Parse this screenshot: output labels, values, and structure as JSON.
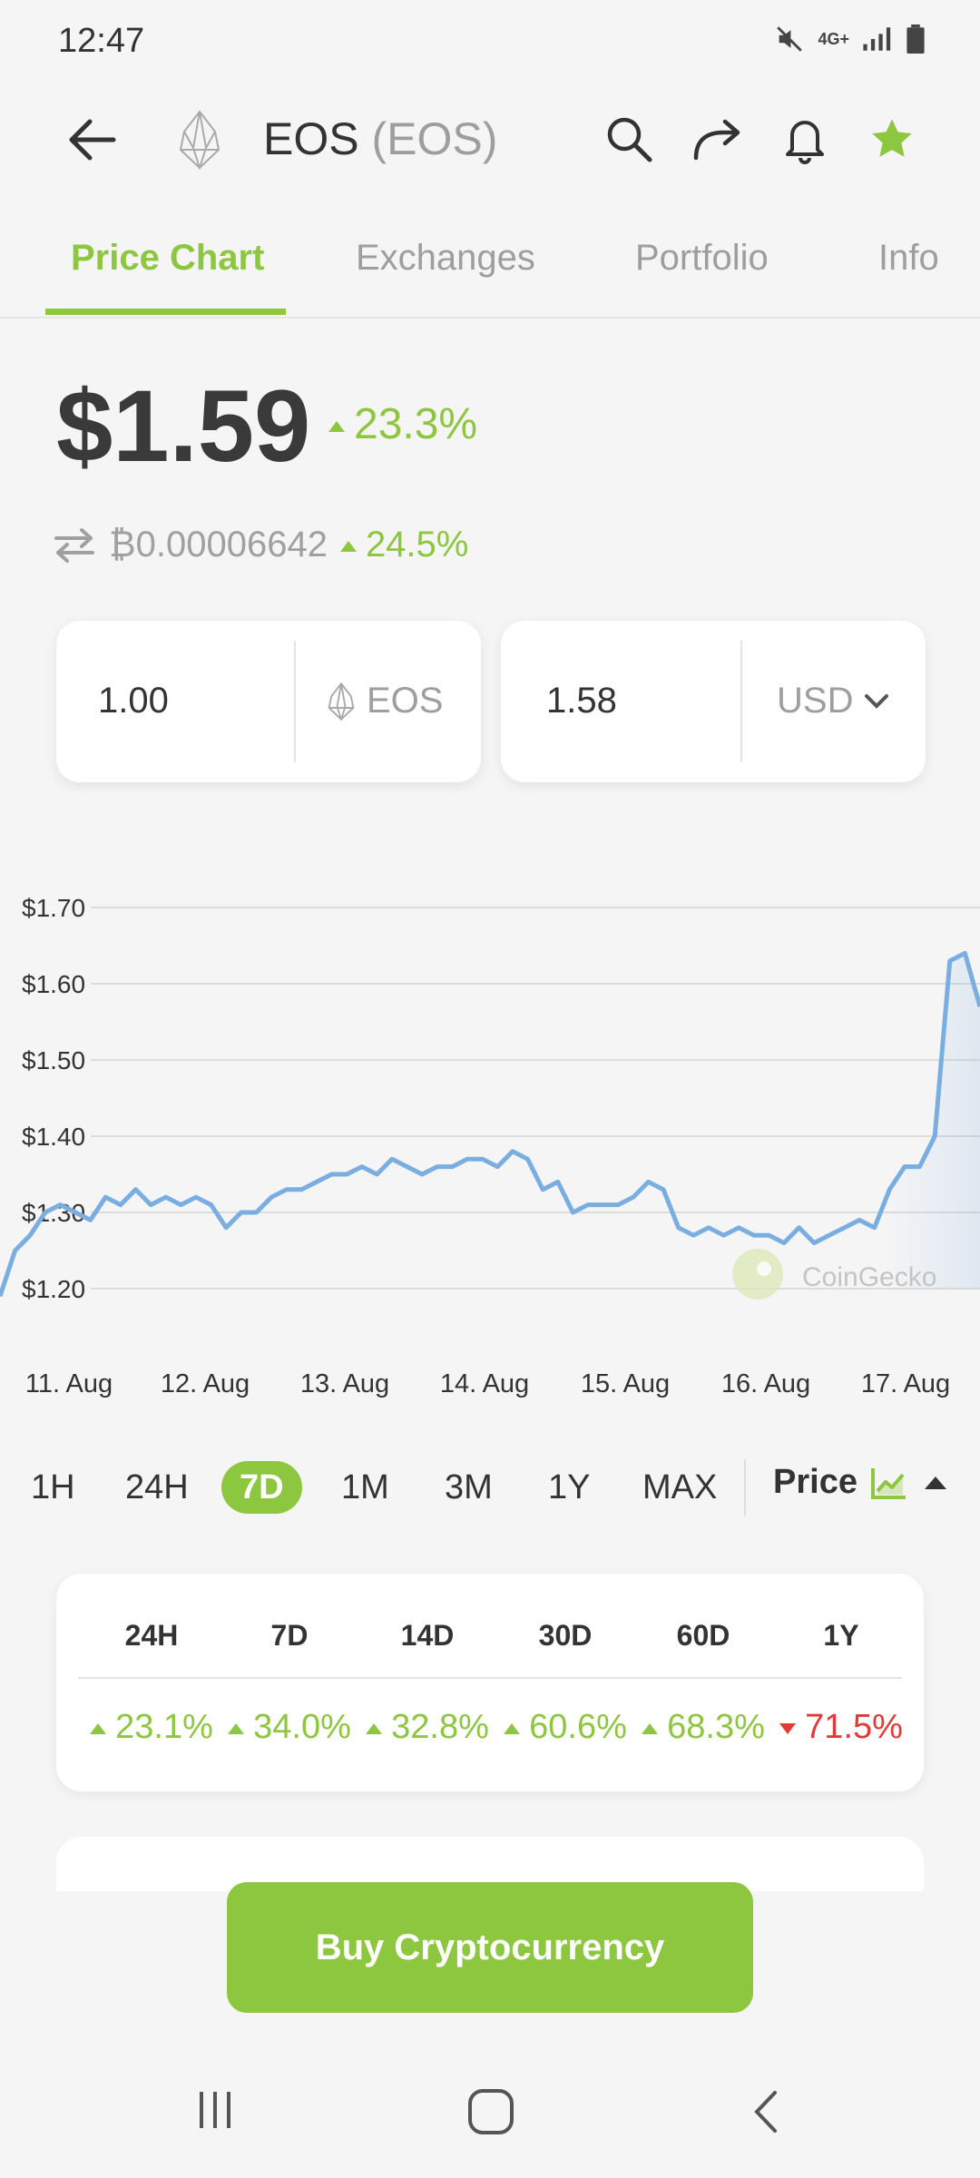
{
  "status_bar": {
    "time": "12:47",
    "network": "4G+"
  },
  "header": {
    "name": "EOS",
    "symbol": "(EOS)"
  },
  "tabs": [
    {
      "label": "Price Chart",
      "active": true
    },
    {
      "label": "Exchanges",
      "active": false
    },
    {
      "label": "Portfolio",
      "active": false
    },
    {
      "label": "Info",
      "active": false
    }
  ],
  "price": {
    "value": "$1.59",
    "change": "23.3%"
  },
  "btc": {
    "value": "₿0.00006642",
    "change": "24.5%"
  },
  "converter": {
    "left_value": "1.00",
    "left_unit": "EOS",
    "right_value": "1.58",
    "right_unit": "USD"
  },
  "chart_data": {
    "type": "line",
    "y_ticks": [
      "$1.70",
      "$1.60",
      "$1.50",
      "$1.40",
      "$1.30",
      "$1.20"
    ],
    "ylim": [
      1.2,
      1.7
    ],
    "x_ticks": [
      "11. Aug",
      "12. Aug",
      "13. Aug",
      "14. Aug",
      "15. Aug",
      "16. Aug",
      "17. Aug"
    ],
    "watermark": "CoinGecko",
    "series": [
      {
        "values": [
          1.19,
          1.25,
          1.27,
          1.3,
          1.31,
          1.3,
          1.29,
          1.32,
          1.31,
          1.33,
          1.31,
          1.32,
          1.31,
          1.32,
          1.31,
          1.28,
          1.3,
          1.3,
          1.32,
          1.33,
          1.33,
          1.34,
          1.35,
          1.35,
          1.36,
          1.35,
          1.37,
          1.36,
          1.35,
          1.36,
          1.36,
          1.37,
          1.37,
          1.36,
          1.38,
          1.37,
          1.33,
          1.34,
          1.3,
          1.31,
          1.31,
          1.31,
          1.32,
          1.34,
          1.33,
          1.28,
          1.27,
          1.28,
          1.27,
          1.28,
          1.27,
          1.27,
          1.26,
          1.28,
          1.26,
          1.27,
          1.28,
          1.29,
          1.28,
          1.33,
          1.36,
          1.36,
          1.4,
          1.63,
          1.64,
          1.57
        ],
        "color": "#7aaee0"
      }
    ],
    "grid": true
  },
  "ranges": [
    {
      "label": "1H",
      "active": false
    },
    {
      "label": "24H",
      "active": false
    },
    {
      "label": "7D",
      "active": true
    },
    {
      "label": "1M",
      "active": false
    },
    {
      "label": "3M",
      "active": false
    },
    {
      "label": "1Y",
      "active": false
    },
    {
      "label": "MAX",
      "active": false
    }
  ],
  "price_toggle": "Price",
  "performance": [
    {
      "period": "24H",
      "change": "23.1%",
      "direction": "up"
    },
    {
      "period": "7D",
      "change": "34.0%",
      "direction": "up"
    },
    {
      "period": "14D",
      "change": "32.8%",
      "direction": "up"
    },
    {
      "period": "30D",
      "change": "60.6%",
      "direction": "up"
    },
    {
      "period": "60D",
      "change": "68.3%",
      "direction": "up"
    },
    {
      "period": "1Y",
      "change": "71.5%",
      "direction": "down"
    }
  ],
  "buy_button": "Buy Cryptocurrency",
  "colors": {
    "accent": "#8dc63f",
    "negative": "#e53935",
    "line": "#7aaee0"
  }
}
